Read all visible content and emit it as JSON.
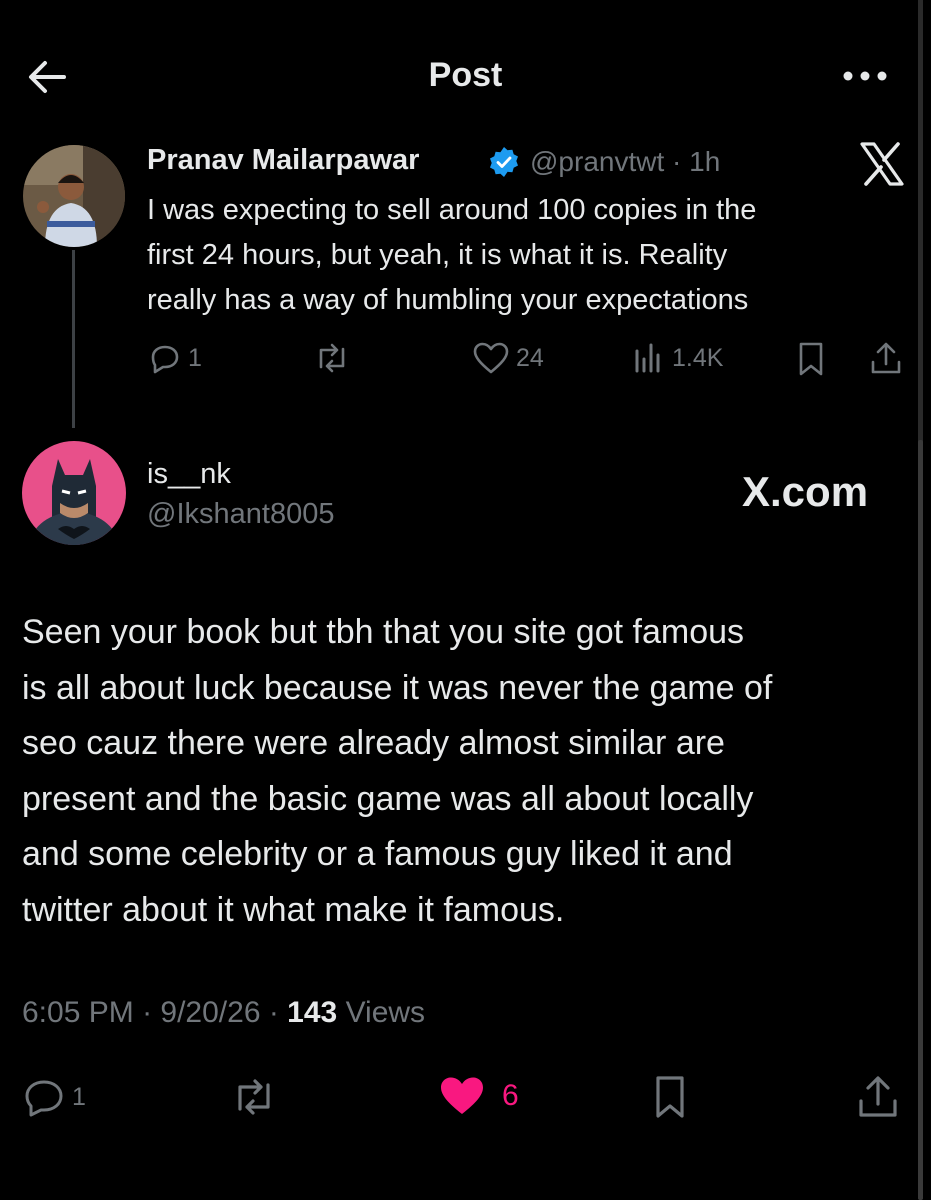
{
  "header": {
    "title": "Post"
  },
  "quoted_post": {
    "author_name": "Pranav Mailarpawar",
    "author_handle": "@pranvtwt",
    "time": "1h",
    "text_lines": [
      "I was expecting to sell around 100 copies in the",
      "first 24 hours, but yeah, it is what it is. Reality",
      "really has a way of humbling your expectations"
    ],
    "replies": "1",
    "likes": "24",
    "views": "1.4K"
  },
  "reply_post": {
    "author_name": "is__nk",
    "author_handle": "@Ikshant8005",
    "brand_label": "X.com",
    "text_lines": [
      "Seen your book but tbh that you site got famous",
      "is all about luck because it was never the game of",
      "seo cauz there were already almost similar are",
      "present and the basic game was all about locally",
      "and some celebrity or a famous guy liked it and",
      "twitter about it what make it famous."
    ],
    "time": "6:05 PM",
    "date": "9/20/26",
    "views_count": "143",
    "views_label": "Views",
    "replies": "1",
    "likes": "6"
  },
  "colors": {
    "background": "#000000",
    "text": "#e7e9ea",
    "secondary": "#71767b",
    "verified": "#1d9bf0",
    "like": "#f91880"
  }
}
